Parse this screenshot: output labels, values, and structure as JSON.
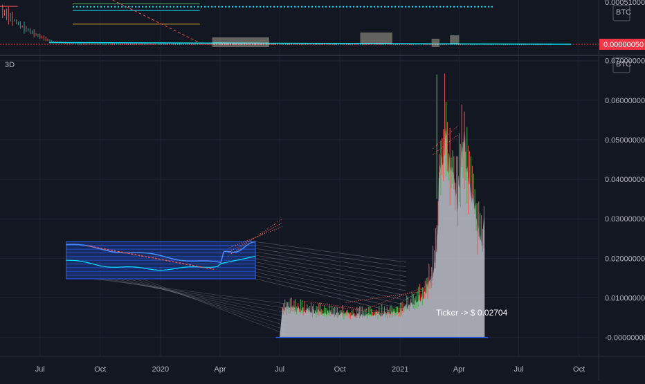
{
  "colors": {
    "background": "#131722",
    "grid": "#1f2433",
    "axis_text": "#b2b5be",
    "divider": "#2a2e39",
    "up": "#26a69a",
    "down": "#ef5350",
    "green_bright": "#4caf50",
    "cyan": "#00e5ff",
    "blue": "#2962ff",
    "area": "#b8bcc4",
    "price_badge": "#f23645"
  },
  "top_pane": {
    "currency_label": "BTC",
    "ticks": [
      {
        "label": "0.00051000",
        "value": 0.00051
      }
    ],
    "current_price": {
      "label": "0.00000050",
      "value": 5e-07
    }
  },
  "main_pane": {
    "interval_label": "3D",
    "currency_label": "BTC",
    "annotation": "Ticker -> $ 0.02704"
  },
  "chart_data": [
    {
      "type": "line",
      "pane": "top",
      "x_range": [
        "2019-05-01",
        "2021-10-31"
      ],
      "ylim": [
        5e-07,
        0.00052
      ],
      "y_ticks": [
        0.00051
      ],
      "current_price": 5e-07,
      "series": [
        {
          "style": "candles",
          "x": [
            "2019-05-05",
            "2019-05-20",
            "2019-06-05",
            "2019-06-25",
            "2019-07-20",
            "2019-08-30",
            "2020-02-01",
            "2021-01-01",
            "2021-08-20"
          ],
          "y": [
            0.0004,
            0.00031,
            0.00021,
            0.00012,
            3e-05,
            4e-06,
            2e-06,
            1e-06,
            9e-07
          ]
        }
      ],
      "levels": [
        {
          "y": 0.00049,
          "x_range": [
            "2019-08-20",
            "2020-03-01"
          ],
          "color": "#4caf50"
        },
        {
          "y": 0.000455,
          "x_range": [
            "2019-08-20",
            "2021-05-25"
          ],
          "color": "#00e5ff",
          "style": "dotted"
        },
        {
          "y": 0.00041,
          "x_range": [
            "2019-08-20",
            "2020-03-01"
          ],
          "color": "#00e5ff"
        },
        {
          "y": 0.000245,
          "x_range": [
            "2019-08-20",
            "2020-03-01"
          ],
          "color": "#c9a227"
        }
      ]
    },
    {
      "type": "area",
      "pane": "main",
      "x_range": [
        "2019-05-01",
        "2021-10-31"
      ],
      "x_ticks": [
        {
          "label": "Jul",
          "date": "2019-07-01"
        },
        {
          "label": "Oct",
          "date": "2019-10-01"
        },
        {
          "label": "2020",
          "date": "2020-01-01"
        },
        {
          "label": "Apr",
          "date": "2020-04-01"
        },
        {
          "label": "Jul",
          "date": "2020-07-01"
        },
        {
          "label": "Oct",
          "date": "2020-10-01"
        },
        {
          "label": "2021",
          "date": "2021-01-01"
        },
        {
          "label": "Apr",
          "date": "2021-04-01"
        },
        {
          "label": "Jul",
          "date": "2021-07-01"
        },
        {
          "label": "Oct",
          "date": "2021-10-01"
        }
      ],
      "y_ticks": [
        {
          "label": "-0.00000000",
          "value": 0
        },
        {
          "label": "0.01000000",
          "value": 0.01
        },
        {
          "label": "0.02000000",
          "value": 0.02
        },
        {
          "label": "0.03000000",
          "value": 0.03
        },
        {
          "label": "0.04000000",
          "value": 0.04
        },
        {
          "label": "0.05000000",
          "value": 0.05
        },
        {
          "label": "0.06000000",
          "value": 0.06
        },
        {
          "label": "0.07000000",
          "value": 0.07
        }
      ],
      "ylim": [
        -0.0034,
        0.071
      ],
      "grid": true,
      "series": [
        {
          "style": "area+candles",
          "x": [
            "2020-07-05",
            "2020-07-25",
            "2020-08-15",
            "2020-09-05",
            "2020-09-25",
            "2020-10-15",
            "2020-11-05",
            "2020-11-25",
            "2020-12-15",
            "2021-01-01",
            "2021-01-20",
            "2021-02-05",
            "2021-02-15",
            "2021-02-25",
            "2021-03-01",
            "2021-03-06",
            "2021-03-12",
            "2021-03-18",
            "2021-03-24",
            "2021-03-30",
            "2021-04-04",
            "2021-04-10",
            "2021-04-16",
            "2021-04-22",
            "2021-04-28",
            "2021-05-04",
            "2021-05-10"
          ],
          "y": [
            0.0075,
            0.0072,
            0.0068,
            0.0065,
            0.0061,
            0.0058,
            0.0057,
            0.0059,
            0.0062,
            0.0068,
            0.0085,
            0.0105,
            0.014,
            0.02,
            0.038,
            0.045,
            0.052,
            0.041,
            0.038,
            0.035,
            0.046,
            0.048,
            0.041,
            0.036,
            0.028,
            0.024,
            0.029
          ]
        }
      ],
      "base_line": {
        "y": 0,
        "x_range": [
          "2020-06-25",
          "2021-05-15"
        ],
        "color": "#2962ff"
      }
    }
  ]
}
